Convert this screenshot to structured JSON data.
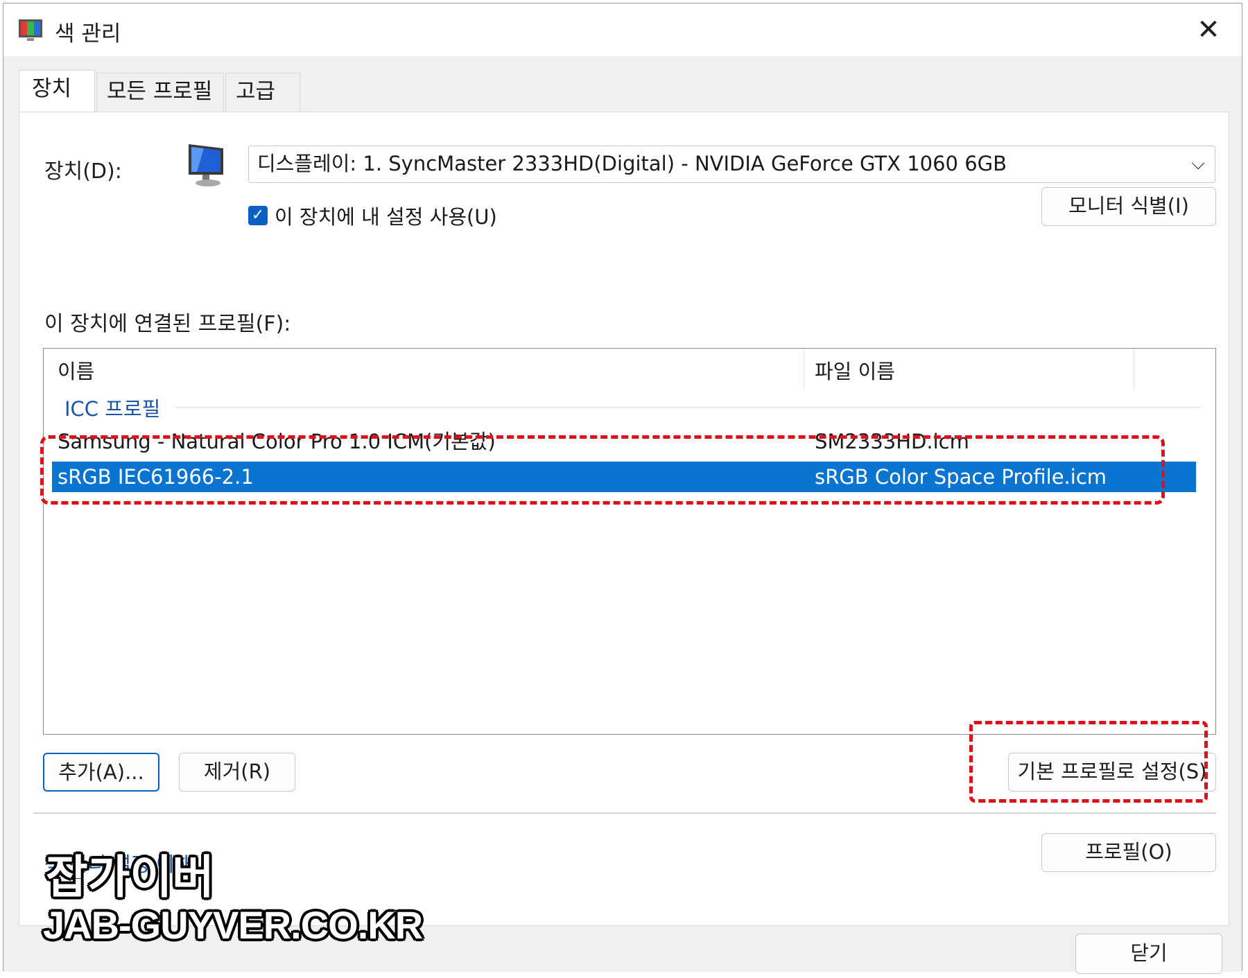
{
  "window": {
    "title": "색 관리",
    "close_glyph": "✕"
  },
  "tabs": [
    {
      "label": "장치",
      "active": true
    },
    {
      "label": "모든 프로필",
      "active": false
    },
    {
      "label": "고급",
      "active": false
    }
  ],
  "device": {
    "label": "장치(D):",
    "selected": "디스플레이: 1. SyncMaster 2333HD(Digital) - NVIDIA GeForce GTX 1060 6GB",
    "arrow": "⌵",
    "use_settings_label": "이 장치에 내 설정 사용(U)",
    "use_settings_checked": true,
    "identify_button": "모니터 식별(I)"
  },
  "profiles": {
    "label": "이 장치에 연결된 프로필(F):",
    "columns": [
      "이름",
      "파일 이름"
    ],
    "group": "ICC 프로필",
    "rows": [
      {
        "name": "Samsung - Natural Color Pro 1.0 ICM(기본값)",
        "file": "SM2333HD.icm",
        "selected": false
      },
      {
        "name": "sRGB IEC61966-2.1",
        "file": "sRGB Color Space Profile.icm",
        "selected": true
      }
    ]
  },
  "buttons": {
    "add": "추가(A)...",
    "remove": "제거(R)",
    "set_default": "기본 프로필로 설정(S)",
    "profile": "프로필(O)",
    "close": "닫기"
  },
  "link": "색 관리 설정 이해",
  "watermark": {
    "korean": "잡가이버",
    "url": "JAB-GUYVER.CO.KR"
  },
  "colors": {
    "selection": "#0b74d0",
    "checkbox": "#0a5fc4",
    "highlight_box": "#e0101a"
  }
}
